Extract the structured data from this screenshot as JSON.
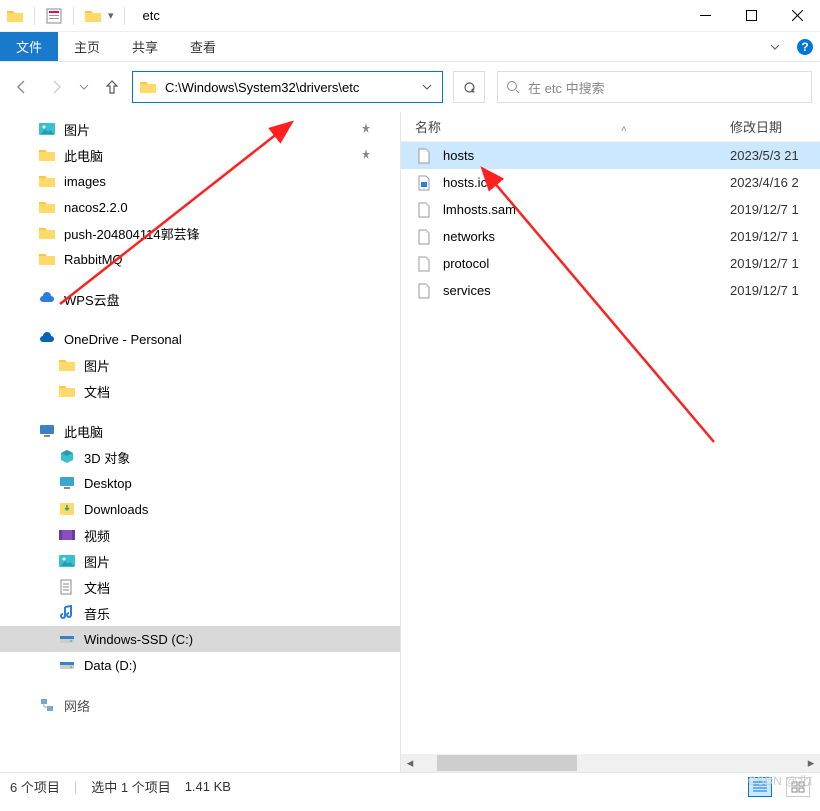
{
  "window": {
    "title": "etc"
  },
  "ribbon": {
    "file": "文件",
    "tabs": [
      "主页",
      "共享",
      "查看"
    ]
  },
  "nav": {
    "path": "C:\\Windows\\System32\\drivers\\etc",
    "search_placeholder": "在 etc 中搜索"
  },
  "tree": {
    "quick": [
      {
        "label": "图片",
        "icon": "picture",
        "pinned": true
      },
      {
        "label": "此电脑",
        "icon": "folder",
        "pinned": true
      },
      {
        "label": "images",
        "icon": "folder"
      },
      {
        "label": "nacos2.2.0",
        "icon": "folder"
      },
      {
        "label": "push-204804114郭芸锋",
        "icon": "folder"
      },
      {
        "label": "RabbitMQ",
        "icon": "folder"
      }
    ],
    "wps": "WPS云盘",
    "onedrive": "OneDrive - Personal",
    "onedrive_children": [
      {
        "label": "图片",
        "icon": "folder"
      },
      {
        "label": "文档",
        "icon": "folder"
      }
    ],
    "thispc": "此电脑",
    "thispc_children": [
      {
        "label": "3D 对象",
        "icon": "3d"
      },
      {
        "label": "Desktop",
        "icon": "desktop"
      },
      {
        "label": "Downloads",
        "icon": "downloads"
      },
      {
        "label": "视频",
        "icon": "video"
      },
      {
        "label": "图片",
        "icon": "picture"
      },
      {
        "label": "文档",
        "icon": "documents"
      },
      {
        "label": "音乐",
        "icon": "music"
      },
      {
        "label": "Windows-SSD (C:)",
        "icon": "disk",
        "selected": true
      },
      {
        "label": "Data (D:)",
        "icon": "disk"
      }
    ],
    "network": "网络"
  },
  "columns": {
    "name": "名称",
    "date": "修改日期"
  },
  "files": [
    {
      "name": "hosts",
      "icon": "file",
      "date": "2023/5/3 21",
      "selected": true
    },
    {
      "name": "hosts.ics",
      "icon": "ics",
      "date": "2023/4/16 2"
    },
    {
      "name": "lmhosts.sam",
      "icon": "file",
      "date": "2019/12/7 1"
    },
    {
      "name": "networks",
      "icon": "file",
      "date": "2019/12/7 1"
    },
    {
      "name": "protocol",
      "icon": "file",
      "date": "2019/12/7 1"
    },
    {
      "name": "services",
      "icon": "file",
      "date": "2019/12/7 1"
    }
  ],
  "status": {
    "count": "6 个项目",
    "selection": "选中 1 个项目",
    "size": "1.41 KB"
  },
  "watermark": "CSDN @北ǐ"
}
